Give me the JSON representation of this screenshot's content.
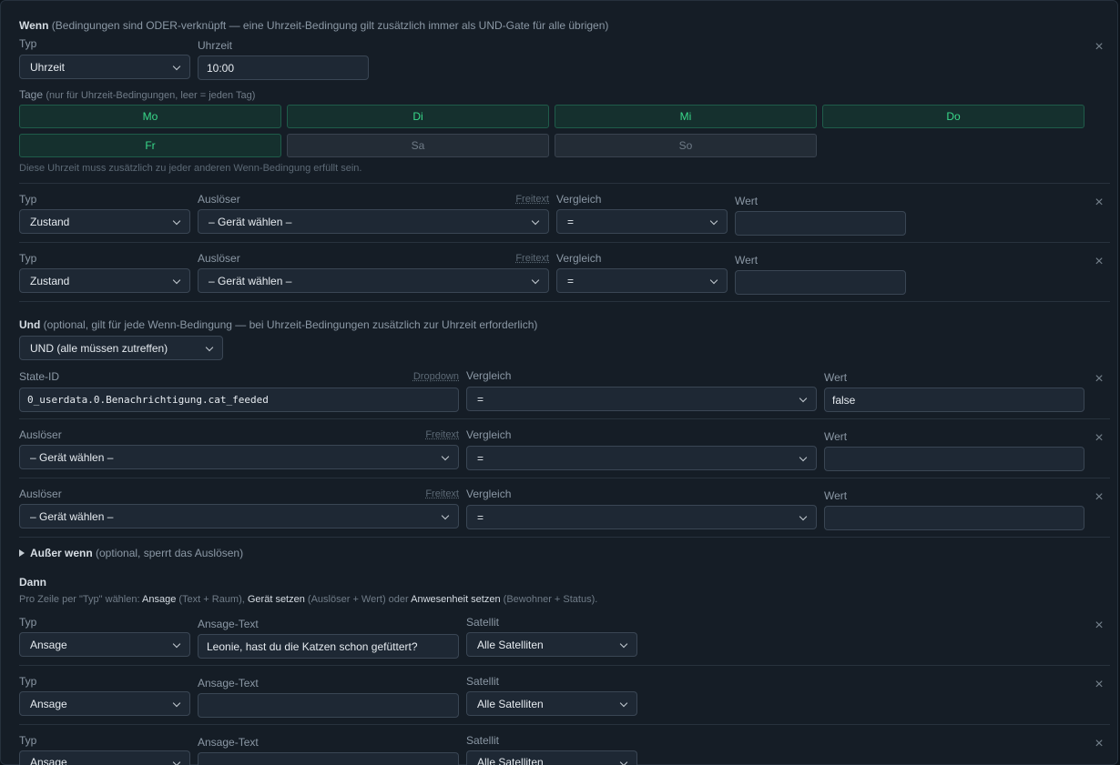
{
  "wenn": {
    "title": "Wenn",
    "subtitle": "(Bedingungen sind ODER-verknüpft — eine Uhrzeit-Bedingung gilt zusätzlich immer als UND-Gate für alle übrigen)",
    "time_row": {
      "typ_label": "Typ",
      "typ_value": "Uhrzeit",
      "uhrzeit_label": "Uhrzeit",
      "uhrzeit_value": "10:00",
      "tage_label": "Tage",
      "tage_hint": "(nur für Uhrzeit-Bedingungen, leer = jeden Tag)",
      "days": [
        {
          "label": "Mo",
          "active": true
        },
        {
          "label": "Di",
          "active": true
        },
        {
          "label": "Mi",
          "active": true
        },
        {
          "label": "Do",
          "active": true
        },
        {
          "label": "Fr",
          "active": true
        },
        {
          "label": "Sa",
          "active": false
        },
        {
          "label": "So",
          "active": false
        }
      ],
      "note": "Diese Uhrzeit muss zusätzlich zu jeder anderen Wenn-Bedingung erfüllt sein."
    },
    "rows": [
      {
        "typ_label": "Typ",
        "typ": "Zustand",
        "ausloeser_label": "Auslöser",
        "freitext": "Freitext",
        "ausloeser": "– Gerät wählen –",
        "vergleich_label": "Vergleich",
        "vergleich": "=",
        "wert_label": "Wert",
        "wert": ""
      },
      {
        "typ_label": "Typ",
        "typ": "Zustand",
        "ausloeser_label": "Auslöser",
        "freitext": "Freitext",
        "ausloeser": "– Gerät wählen –",
        "vergleich_label": "Vergleich",
        "vergleich": "=",
        "wert_label": "Wert",
        "wert": ""
      }
    ]
  },
  "und": {
    "title": "Und",
    "subtitle": "(optional, gilt für jede Wenn-Bedingung — bei Uhrzeit-Bedingungen zusätzlich zur Uhrzeit erforderlich)",
    "mode": "UND (alle müssen zutreffen)",
    "state_row": {
      "label": "State-ID",
      "dropdown": "Dropdown",
      "value": "0_userdata.0.Benachrichtigung.cat_feeded",
      "vergleich_label": "Vergleich",
      "vergleich": "=",
      "wert_label": "Wert",
      "wert": "false"
    },
    "rows": [
      {
        "ausloeser_label": "Auslöser",
        "freitext": "Freitext",
        "ausloeser": "– Gerät wählen –",
        "vergleich_label": "Vergleich",
        "vergleich": "=",
        "wert_label": "Wert",
        "wert": ""
      },
      {
        "ausloeser_label": "Auslöser",
        "freitext": "Freitext",
        "ausloeser": "– Gerät wählen –",
        "vergleich_label": "Vergleich",
        "vergleich": "=",
        "wert_label": "Wert",
        "wert": ""
      }
    ]
  },
  "ausser": {
    "title": "Außer wenn",
    "subtitle": "(optional, sperrt das Auslösen)"
  },
  "dann": {
    "title": "Dann",
    "note": {
      "p1": "Pro Zeile per \"Typ\" wählen:",
      "k1": "Ansage",
      "p2": "(Text + Raum),",
      "k2": "Gerät setzen",
      "p3": "(Auslöser + Wert) oder",
      "k3": "Anwesenheit setzen",
      "p4": "(Bewohner + Status)."
    },
    "rows": [
      {
        "typ_label": "Typ",
        "typ": "Ansage",
        "text_label": "Ansage-Text",
        "text": "Leonie, hast du die Katzen schon gefüttert?",
        "sat_label": "Satellit",
        "sat": "Alle Satelliten"
      },
      {
        "typ_label": "Typ",
        "typ": "Ansage",
        "text_label": "Ansage-Text",
        "text": "",
        "sat_label": "Satellit",
        "sat": "Alle Satelliten"
      },
      {
        "typ_label": "Typ",
        "typ": "Ansage",
        "text_label": "Ansage-Text",
        "text": "",
        "sat_label": "Satellit",
        "sat": "Alle Satelliten"
      }
    ]
  },
  "icons": {
    "remove": "close-icon",
    "expand": "triangle-right-icon",
    "dropdown": "chevron-down-icon"
  },
  "colors": {
    "background": "#151d26",
    "field": "#1e2834",
    "accent_active": "#39d98a",
    "text": "#e6ebf0"
  }
}
